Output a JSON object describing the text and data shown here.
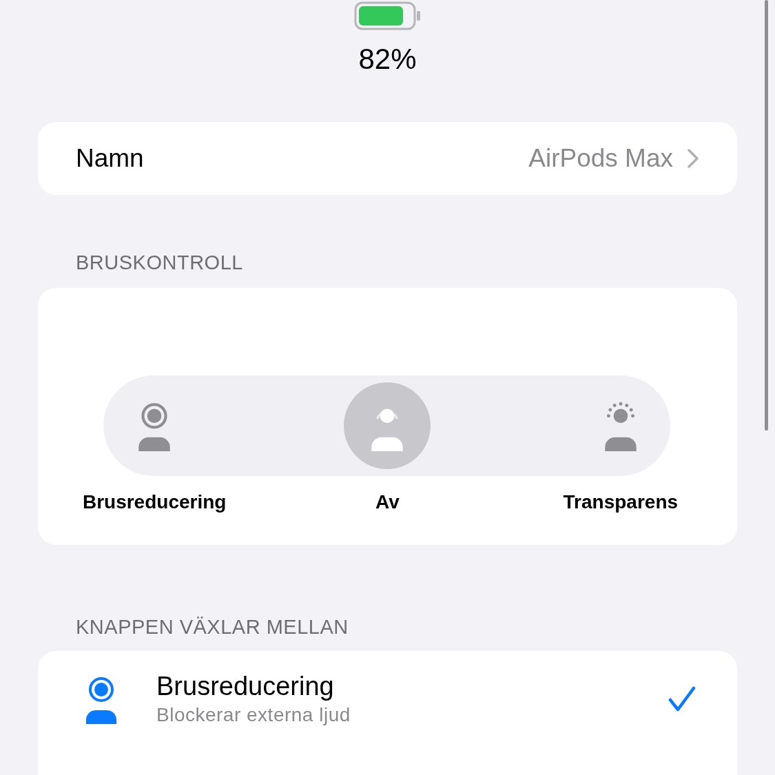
{
  "battery": {
    "percent": "82%"
  },
  "name_row": {
    "label": "Namn",
    "value": "AirPods Max"
  },
  "noise_control": {
    "header": "BRUSKONTROLL",
    "modes": [
      {
        "kind": "noise-cancellation",
        "label": "Brusreducering",
        "selected": false
      },
      {
        "kind": "off",
        "label": "Av",
        "selected": true
      },
      {
        "kind": "transparency",
        "label": "Transparens",
        "selected": false
      }
    ]
  },
  "button_toggles": {
    "header": "KNAPPEN VÄXLAR MELLAN",
    "items": [
      {
        "kind": "noise-cancellation",
        "title": "Brusreducering",
        "subtitle": "Blockerar externa ljud",
        "checked": true
      }
    ]
  }
}
